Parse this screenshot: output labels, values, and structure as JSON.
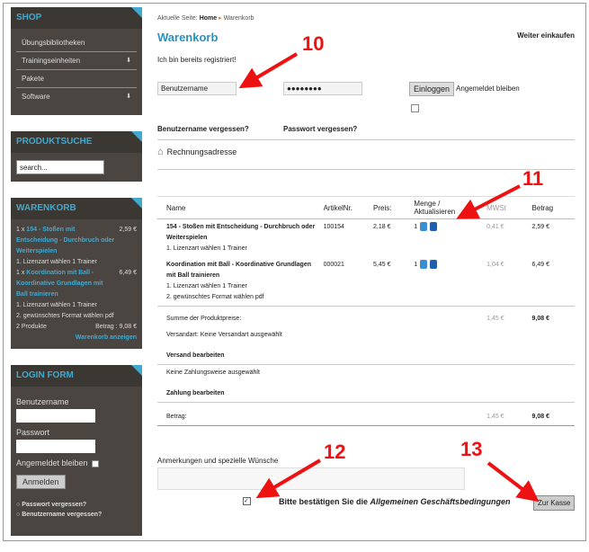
{
  "sidebar": {
    "shop": {
      "title": "SHOP",
      "items": [
        {
          "label": "Übungsbibliotheken",
          "arrow": ""
        },
        {
          "label": "Trainingseinheiten",
          "arrow": "⬇"
        },
        {
          "label": "Pakete",
          "arrow": ""
        },
        {
          "label": "Software",
          "arrow": "⬇"
        }
      ]
    },
    "produktsuche": {
      "title": "PRODUKTSUCHE",
      "search_value": "search..."
    },
    "warenkorb": {
      "title": "WARENKORB",
      "item1_qty": "1 x ",
      "item1_link": "154 - Stoßen mit Entscheidung - Durchbruch oder Weiterspielen",
      "item1_price": "2,59 €",
      "item1_opt": "1. Lizenzart wählen 1 Trainer",
      "item2_qty": "1 x ",
      "item2_link": "Koordination mit Ball - Koordinative Grundlagen mit Ball trainieren",
      "item2_price": "6,49 €",
      "item2_opt1": "1. Lizenzart wählen 1 Trainer",
      "item2_opt2": "2. gewünschtes Format wählen pdf",
      "count": "2 Produkte",
      "total": "Betrag : 9,08 €",
      "show_link": "Warenkorb anzeigen"
    },
    "login": {
      "title": "LOGIN FORM",
      "user_label": "Benutzername",
      "pass_label": "Passwort",
      "remember": "Angemeldet bleiben",
      "button": "Anmelden",
      "links": [
        "Passwort vergessen?",
        "Benutzername vergessen?"
      ]
    }
  },
  "main": {
    "breadcrumb": {
      "prefix": "Aktuelle Seite:",
      "home": "Home",
      "sep": "▸",
      "current": "Warenkorb"
    },
    "continue": "Weiter einkaufen",
    "title": "Warenkorb",
    "registered": "Ich bin bereits registriert!",
    "username_value": "Benutzername",
    "password_value": "●●●●●●●●",
    "login_button": "Einloggen",
    "remember": "Angemeldet bleiben",
    "forgot_user": "Benutzername vergessen?",
    "forgot_pass": "Passwort vergessen?",
    "billing": "Rechnungsadresse",
    "table": {
      "headers": [
        "Name",
        "ArtikelNr.",
        "Preis:",
        "Menge / Aktualisieren",
        "MWSt",
        "Betrag"
      ],
      "rows": [
        {
          "name": "154 - Stoßen mit Entscheidung - Durchbruch oder Weiterspielen",
          "opt1": "1. Lizenzart wählen 1 Trainer",
          "opt2": "",
          "nr": "100154",
          "price": "2,18 €",
          "qty": "1",
          "mwst": "0,41 €",
          "total": "2,59 €"
        },
        {
          "name": "Koordination mit Ball - Koordinative Grundlagen mit Ball trainieren",
          "opt1": "1. Lizenzart wählen 1 Trainer",
          "opt2": "2. gewünschtes Format wählen pdf",
          "nr": "000021",
          "price": "5,45 €",
          "qty": "1",
          "mwst": "1,04 €",
          "total": "6,49 €"
        }
      ],
      "sum_label": "Summe der Produktpreise:",
      "sum_mwst": "1,45 €",
      "sum_total": "9,08 €",
      "shipping_text": "Versandart: Keine Versandart ausgewählt",
      "shipping_edit": "Versand bearbeiten",
      "payment_text": "Keine Zahlungsweise ausgewählt",
      "payment_edit": "Zahlung bearbeiten",
      "amount_label": "Betrag:",
      "amount_mwst": "1,45 €",
      "amount_total": "9,08 €"
    },
    "comments_label": "Anmerkungen und spezielle Wünsche",
    "agb_prefix": "Bitte bestätigen Sie die ",
    "agb_link": "Allgemeinen Geschäftsbedingungen",
    "checkout": "Zur Kasse"
  },
  "annotations": [
    "10",
    "11",
    "12",
    "13"
  ],
  "colors": {
    "accent": "#41a9cf",
    "sidebar_bg": "#4a4541",
    "annotation": "#ee1111"
  }
}
